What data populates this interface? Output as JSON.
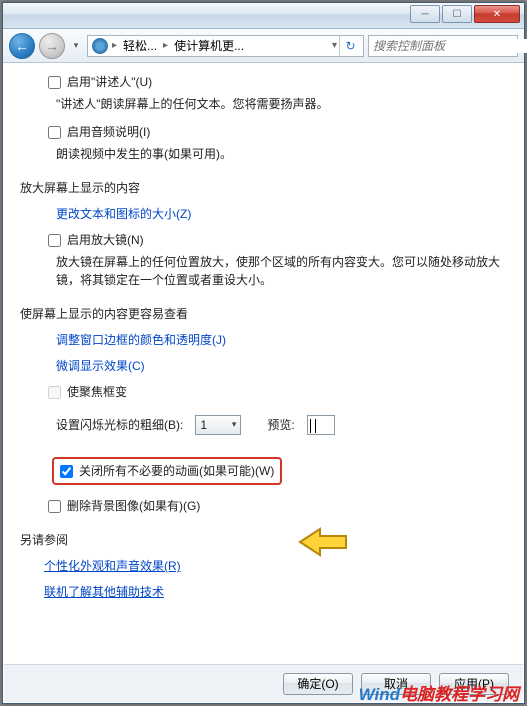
{
  "window": {
    "minimize_glyph": "─",
    "maximize_glyph": "☐",
    "close_glyph": "✕"
  },
  "nav": {
    "back_glyph": "←",
    "fwd_glyph": "→",
    "dropdown_glyph": "▾",
    "refresh_glyph": "↻",
    "search_glyph": "🔍"
  },
  "address": {
    "seg1": "轻松...",
    "seg2": "使计算机更...",
    "arrow": "▸",
    "drop": "▾"
  },
  "search": {
    "placeholder": "搜索控制面板"
  },
  "section_top": {
    "narrator_label": "启用\"讲述人\"(U)",
    "narrator_desc": "\"讲述人\"朗读屏幕上的任何文本。您将需要扬声器。",
    "audio_desc_label": "启用音频说明(I)",
    "audio_desc_desc": "朗读视频中发生的事(如果可用)。"
  },
  "section_magnify": {
    "heading": "放大屏幕上显示的内容",
    "link_text_size": "更改文本和图标的大小(Z)",
    "magnifier_label": "启用放大镜(N)",
    "magnifier_desc": "放大镜在屏幕上的任何位置放大，使那个区域的所有内容变大。您可以随处移动放大镜，将其锁定在一个位置或者重设大小。"
  },
  "section_visibility": {
    "heading": "使屏幕上显示的内容更容易查看",
    "link_border": "调整窗口边框的颜色和透明度(J)",
    "link_effects": "微调显示效果(C)",
    "focus_label": "使聚焦框变",
    "blink_label": "设置闪烁光标的粗细(B):",
    "blink_value": "1",
    "blink_arrow": "▾",
    "preview_label": "预览:",
    "disable_anim_label": "关闭所有不必要的动画(如果可能)(W)",
    "remove_bg_label": "删除背景图像(如果有)(G)"
  },
  "section_refs": {
    "heading": "另请参阅",
    "link_personalize": "个性化外观和声音效果(R)",
    "link_assistive": "联机了解其他辅助技术"
  },
  "buttons": {
    "ok": "确定(O)",
    "cancel": "取消",
    "apply": "应用(P)"
  },
  "watermark": {
    "part1": "Wind",
    "part2": "电脑教程学习网"
  }
}
